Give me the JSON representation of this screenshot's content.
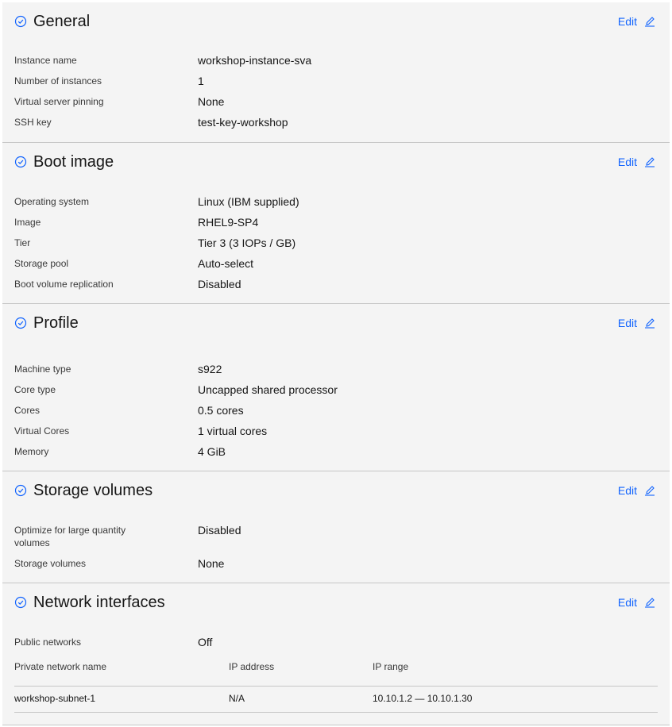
{
  "sections": {
    "general": {
      "title": "General",
      "edit_label": "Edit",
      "rows": [
        {
          "label": "Instance name",
          "value": "workshop-instance-sva"
        },
        {
          "label": "Number of instances",
          "value": "1"
        },
        {
          "label": "Virtual server pinning",
          "value": "None"
        },
        {
          "label": "SSH key",
          "value": "test-key-workshop"
        }
      ]
    },
    "boot_image": {
      "title": "Boot image",
      "edit_label": "Edit",
      "rows": [
        {
          "label": "Operating system",
          "value": "Linux (IBM supplied)"
        },
        {
          "label": "Image",
          "value": "RHEL9-SP4"
        },
        {
          "label": "Tier",
          "value": "Tier 3 (3 IOPs / GB)"
        },
        {
          "label": "Storage pool",
          "value": "Auto-select"
        },
        {
          "label": "Boot volume replication",
          "value": "Disabled"
        }
      ]
    },
    "profile": {
      "title": "Profile",
      "edit_label": "Edit",
      "rows": [
        {
          "label": "Machine type",
          "value": "s922"
        },
        {
          "label": "Core type",
          "value": "Uncapped shared processor"
        },
        {
          "label": "Cores",
          "value": "0.5 cores"
        },
        {
          "label": "Virtual Cores",
          "value": "1 virtual cores"
        },
        {
          "label": "Memory",
          "value": "4 GiB"
        }
      ]
    },
    "storage_volumes": {
      "title": "Storage volumes",
      "edit_label": "Edit",
      "rows": [
        {
          "label": "Optimize for large quantity volumes",
          "value": "Disabled"
        },
        {
          "label": "Storage volumes",
          "value": "None"
        }
      ]
    },
    "network_interfaces": {
      "title": "Network interfaces",
      "edit_label": "Edit",
      "rows": [
        {
          "label": "Public networks",
          "value": "Off"
        }
      ],
      "table": {
        "headers": [
          "Private network name",
          "IP address",
          "IP range"
        ],
        "rows": [
          [
            "workshop-subnet-1",
            "N/A",
            "10.10.1.2 — 10.10.1.30"
          ]
        ]
      }
    }
  },
  "icons": {
    "section_status": "checkmark-outline-icon",
    "edit": "edit-pencil-icon"
  },
  "colors": {
    "link": "#0f62fe",
    "background": "#f4f4f4",
    "divider": "#c6c6c6"
  }
}
